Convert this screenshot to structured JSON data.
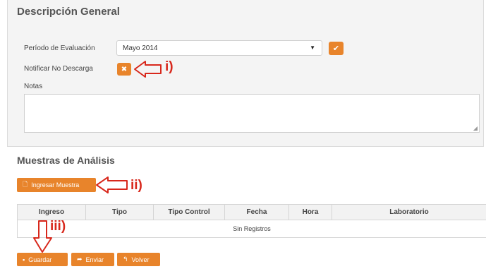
{
  "general": {
    "title": "Descripción General",
    "periodo_label": "Período de Evaluación",
    "periodo_value": "Mayo 2014",
    "notificar_label": "Notificar No Descarga",
    "notas_label": "Notas"
  },
  "muestras": {
    "title": "Muestras de Análisis",
    "ingresar_label": "Ingresar Muestra",
    "columns": [
      "Ingreso",
      "Tipo",
      "Tipo Control",
      "Fecha",
      "Hora",
      "Laboratorio"
    ],
    "empty_text": "Sin Registros"
  },
  "actions": {
    "guardar": "Guardar",
    "enviar": "Enviar",
    "volver": "Volver"
  },
  "annotations": {
    "i": "i)",
    "ii": "ii)",
    "iii": "iii)"
  },
  "colors": {
    "accent": "#e8842b",
    "annotation": "#d8281c"
  }
}
